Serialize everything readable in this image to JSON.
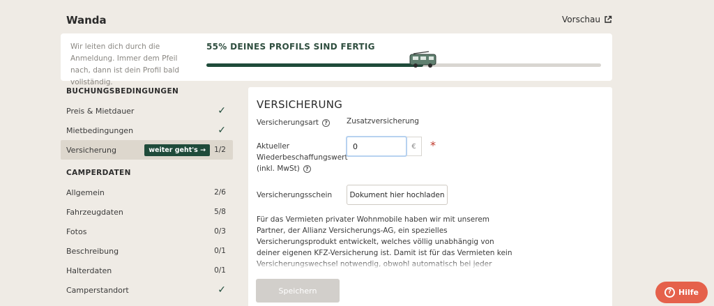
{
  "header": {
    "brand": "Wanda",
    "preview_label": "Vorschau"
  },
  "progress": {
    "intro": "Wir leiten dich durch die Anmeldung. Immer dem Pfeil nach, dann ist dein Profil bald vollständig.",
    "title": "55% DEINES PROFILS SIND FERTIG",
    "percent": 55
  },
  "sidebar": {
    "sections": [
      {
        "title": "BUCHUNGSBEDINGUNGEN",
        "items": [
          {
            "label": "Preis & Mietdauer",
            "status": "check"
          },
          {
            "label": "Mietbedingungen",
            "status": "check"
          },
          {
            "label": "Versicherung",
            "status": "1/2",
            "active": true,
            "pill": "weiter geht's →"
          }
        ]
      },
      {
        "title": "CAMPERDATEN",
        "items": [
          {
            "label": "Allgemein",
            "status": "2/6"
          },
          {
            "label": "Fahrzeugdaten",
            "status": "5/8"
          },
          {
            "label": "Fotos",
            "status": "0/3"
          },
          {
            "label": "Beschreibung",
            "status": "0/1"
          },
          {
            "label": "Halterdaten",
            "status": "0/1"
          },
          {
            "label": "Camperstandort",
            "status": "check"
          }
        ]
      }
    ]
  },
  "main": {
    "title": "VERSICHERUNG",
    "insurance_type_label": "Versicherungsart",
    "insurance_type_value": "Zusatzversicherung",
    "replacement_label_1": "Aktueller",
    "replacement_label_2": "Wiederbeschaffungswert",
    "replacement_label_3": "(inkl. MwSt)",
    "replacement_value": "0",
    "currency": "€",
    "required_mark": "*",
    "certificate_label": "Versicherungsschein",
    "upload_button": "Dokument hier hochladen",
    "paragraph": "Für das Vermieten privater Wohnmobile haben wir mit unserem Partner, der Allianz Versicherungs-AG, ein spezielles Versicherungsprodukt entwickelt, welches völlig unabhängig von deiner eigenen KFZ-Versicherung ist. Damit ist für das Vermieten kein Versicherungswechsel notwendig, obwohl automatisch bei jeder Vermietung die maximale Sicherheit geboten wird. Die dafür notwendige Versicherungsgebühr wird selbstverständlich immer vom Mieter bezahlt. Die",
    "save_button": "Speichern"
  },
  "help": {
    "label": "Hilfe"
  },
  "colors": {
    "accent": "#1f4b3a",
    "help": "#e5614b",
    "background": "#efebe5"
  }
}
